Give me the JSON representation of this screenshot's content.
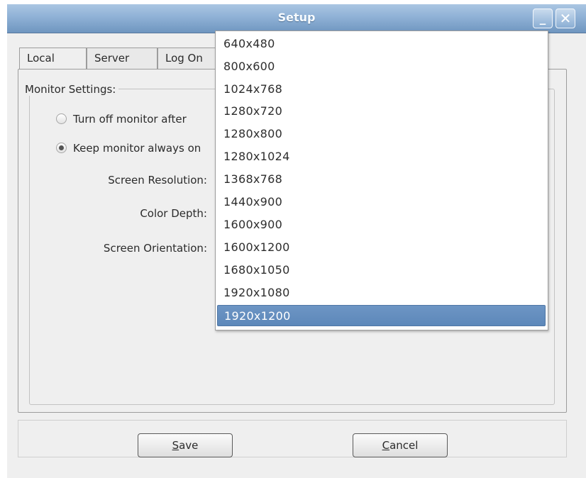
{
  "window": {
    "title": "Setup",
    "minimize_glyph": "_",
    "close_glyph": "✕"
  },
  "tabs": [
    {
      "label": "Local"
    },
    {
      "label": "Server"
    },
    {
      "label": "Log On"
    }
  ],
  "monitor_settings": {
    "group_title": "Monitor Settings:",
    "option_off": {
      "label": "Turn off monitor after",
      "checked": false
    },
    "option_on": {
      "label": "Keep monitor always on",
      "checked": true
    },
    "screen_resolution_label": "Screen Resolution:",
    "color_depth_label": "Color Depth:",
    "screen_orientation_label": "Screen Orientation:"
  },
  "resolution_dropdown": {
    "options": [
      "640x480",
      "800x600",
      "1024x768",
      "1280x720",
      "1280x800",
      "1280x1024",
      "1368x768",
      "1440x900",
      "1600x900",
      "1600x1200",
      "1680x1050",
      "1920x1080",
      "1920x1200"
    ],
    "selected": "1920x1200"
  },
  "buttons": {
    "save": {
      "mnemonic": "S",
      "rest": "ave"
    },
    "cancel": {
      "mnemonic": "C",
      "rest": "ancel"
    }
  },
  "colors": {
    "titlebar": "#8fb1d6",
    "selection": "#5d88ba",
    "background": "#efefef"
  }
}
